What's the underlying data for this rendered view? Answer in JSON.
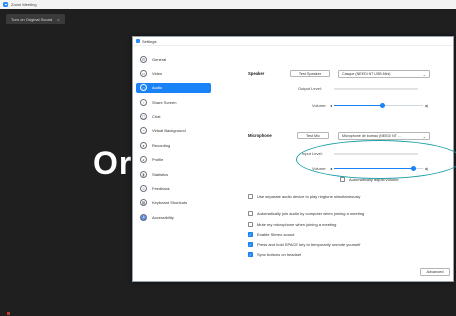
{
  "app_window": {
    "title": "Zoom Meeting"
  },
  "meeting": {
    "sound_tab_label": "Turn on Original Sound",
    "sound_tab_close": "×",
    "shared_text": "Or"
  },
  "settings": {
    "title": "Settings",
    "sidebar": {
      "items": [
        {
          "label": "General",
          "icon": "gear-icon",
          "glyph": "⚙",
          "active": false
        },
        {
          "label": "Video",
          "icon": "video-camera-icon",
          "glyph": "▭",
          "active": false
        },
        {
          "label": "Audio",
          "icon": "headphones-icon",
          "glyph": "∩",
          "active": true
        },
        {
          "label": "Share Screen",
          "icon": "share-screen-icon",
          "glyph": "↑",
          "active": false
        },
        {
          "label": "Chat",
          "icon": "chat-bubble-icon",
          "glyph": "▢",
          "active": false
        },
        {
          "label": "Virtual Background",
          "icon": "person-icon",
          "glyph": "◔",
          "active": false
        },
        {
          "label": "Recording",
          "icon": "recording-icon",
          "glyph": "●",
          "active": false
        },
        {
          "label": "Profile",
          "icon": "profile-icon",
          "glyph": "◕",
          "active": false
        },
        {
          "label": "Statistics",
          "icon": "statistics-icon",
          "glyph": "▮",
          "active": false
        },
        {
          "label": "Feedback",
          "icon": "feedback-icon",
          "glyph": "☺",
          "active": false
        },
        {
          "label": "Keyboard Shortcuts",
          "icon": "keyboard-icon",
          "glyph": "▦",
          "active": false
        },
        {
          "label": "Accessibility",
          "icon": "accessibility-icon",
          "glyph": "♿",
          "active": false
        }
      ]
    },
    "audio": {
      "speaker": {
        "section_label": "Speaker",
        "test_button": "Test Speaker",
        "device": "Casque (NEEDI NT USB Mini)",
        "output_level_label": "Output Level:",
        "volume_label": "Volume:",
        "volume_fraction": 0.55
      },
      "microphone": {
        "section_label": "Microphone",
        "test_button": "Test Mic",
        "device": "Microphone de bureau (NEEDI NT ...",
        "input_level_label": "Input Level:",
        "volume_label": "Volume:",
        "volume_fraction": 0.9,
        "auto_adjust_label": "Automatically adjust volume",
        "auto_adjust_checked": false
      },
      "options": [
        {
          "label": "Use separate audio device to play ringtone simultaneously",
          "checked": false
        },
        {
          "label": "Automatically join audio by computer when joining a meeting",
          "checked": false
        },
        {
          "label": "Mute my microphone when joining a meeting",
          "checked": false
        },
        {
          "label": "Enable Stereo sound",
          "checked": true
        },
        {
          "label": "Press and hold SPACE key to temporarily unmute yourself",
          "checked": true
        },
        {
          "label": "Sync buttons on headset",
          "checked": true
        }
      ],
      "advanced_button": "Advanced"
    }
  },
  "colors": {
    "accent": "#1a82f7",
    "annotation": "#1f9fa8"
  }
}
